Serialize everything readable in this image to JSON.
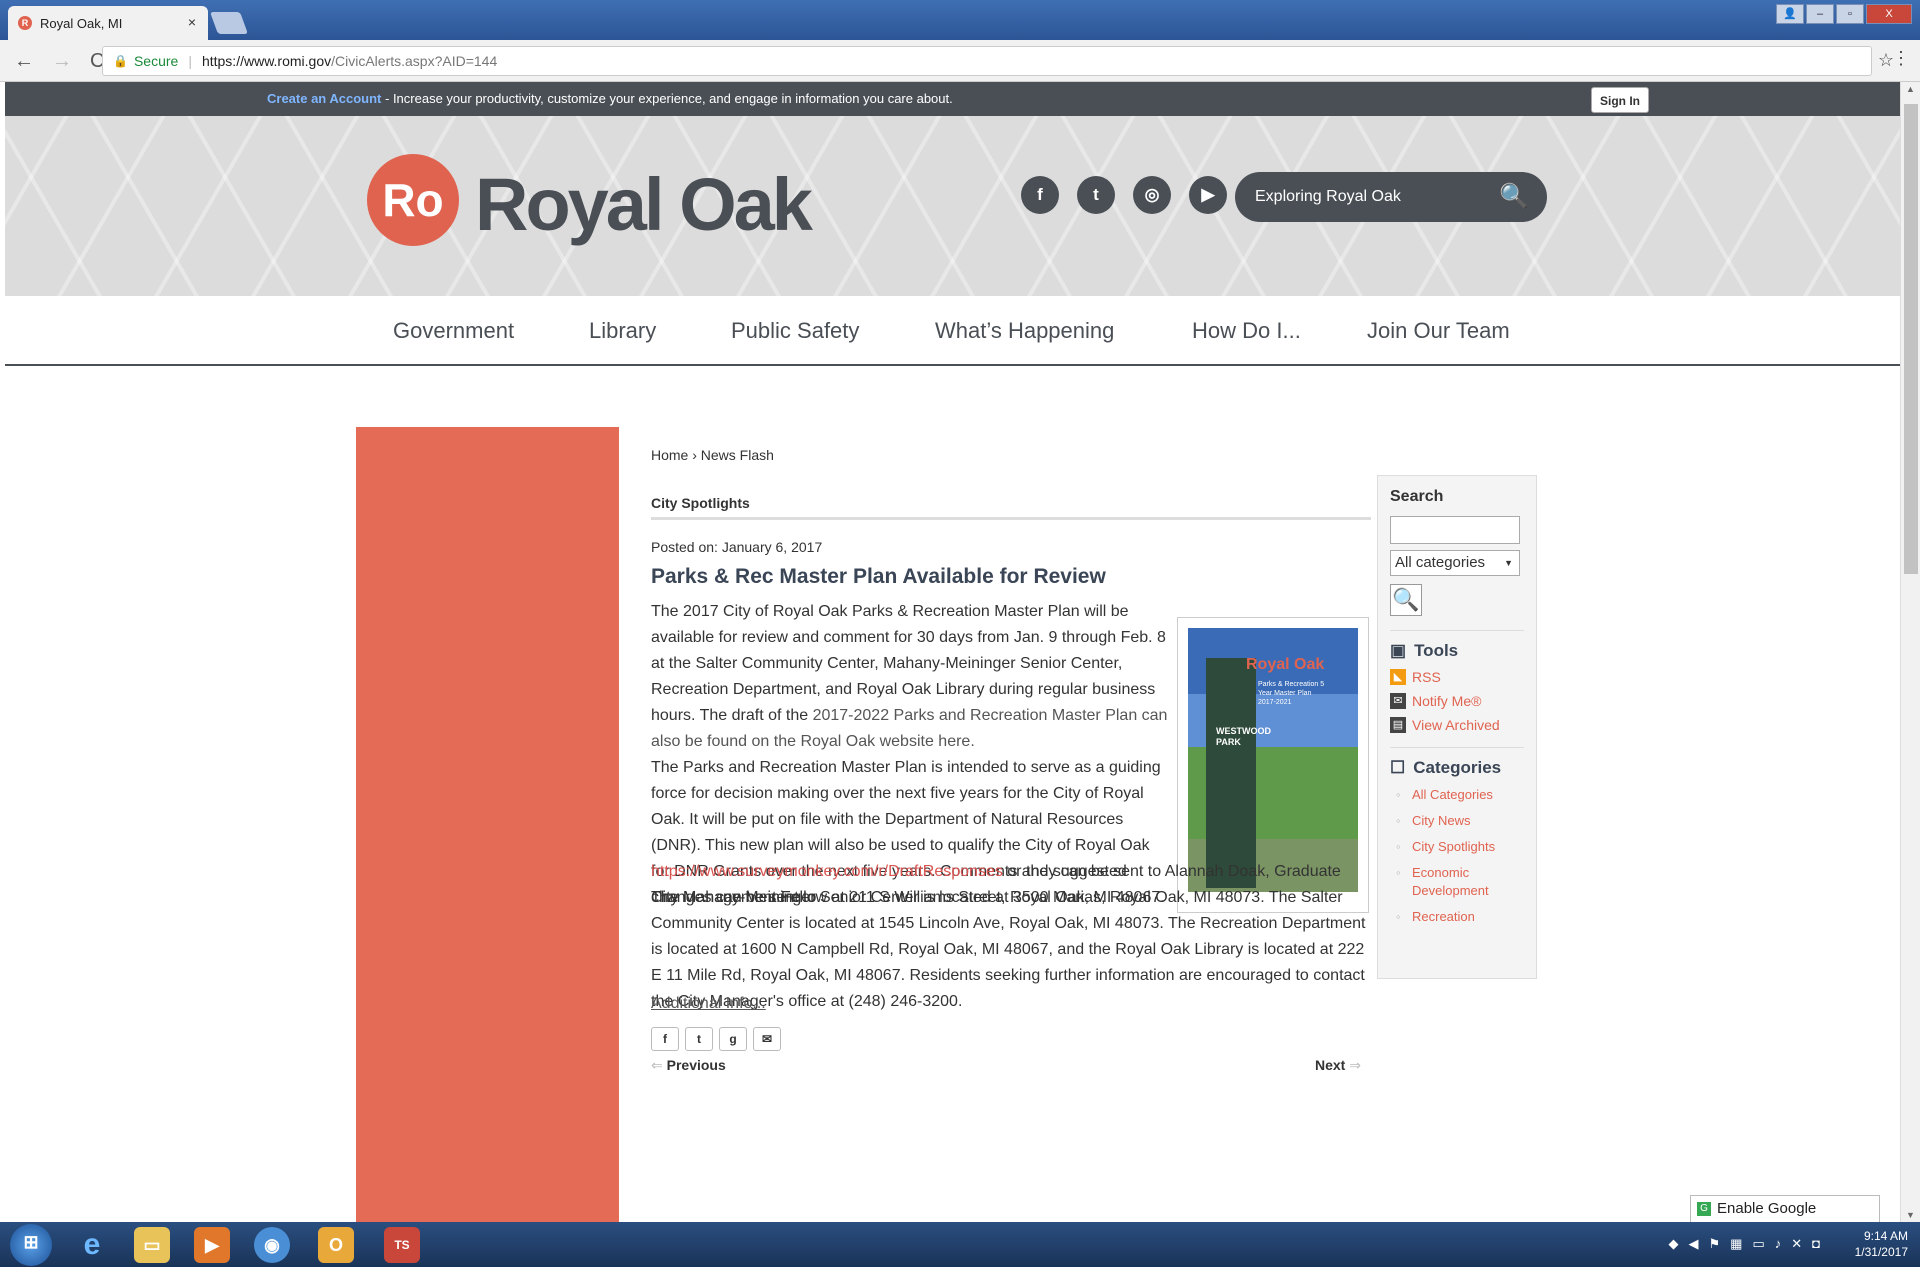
{
  "browser": {
    "tab_title": "Royal Oak, MI",
    "tab_close": "×",
    "secure_label": "Secure",
    "url_host": "https://www.romi.gov",
    "url_path": "/CivicAlerts.aspx?AID=144"
  },
  "topstrip": {
    "create_account": "Create an Account",
    "message": " - Increase your productivity, customize your experience, and engage in information you care about.",
    "sign_in": "Sign In"
  },
  "header": {
    "logo_mark": "Ro",
    "logo_text": "Royal Oak",
    "search_placeholder": "Exploring Royal Oak",
    "social": [
      "f",
      "t",
      "◎",
      "▶"
    ]
  },
  "nav": [
    "Government",
    "Library",
    "Public Safety",
    "What’s Happening",
    "How Do I...",
    "Join Our Team"
  ],
  "article": {
    "breadcrumb": "Home › News Flash",
    "section": "City Spotlights",
    "posted": "Posted on: January 6, 2017",
    "title": "Parks & Rec Master Plan Available for Review",
    "p1_text": "The 2017 City of Royal Oak Parks & Recreation Master Plan will be available for review and comment for 30 days from Jan. 9 through Feb. 8 at the Salter Community Center, Mahany-Meininger Senior Center, Recreation Department, and Royal Oak Library during regular business hours. The draft of the ",
    "p1_link": "2017-2022 Parks and Recreation Master Plan can also be found on the Royal Oak website here.",
    "p2_text": "The Parks and Recreation Master Plan is intended to serve as a guiding force for decision making over the next five years for the City of Royal Oak. It will be put on file with the Department of Natural Resources (DNR). This new plan will also be used to qualify the City of Royal Oak for DNR Grants over the next five years. Comments and suggested changes can be sent to",
    "p2_link": "https://www.surveymonkey.com/r/DraftResponses",
    "p2_tail": " or they can be sent to Alannah Doak, Graduate City Management Fellow at 211 S Williams Street, Royal Oak, MI 48067.",
    "p3_text": "The Mahany-Meininger Senior Center is located at 3500 Marias, Royal Oak, MI 48073. The Salter Community Center is located at 1545 Lincoln Ave, Royal Oak, MI 48073. The Recreation Department is located at 1600 N Campbell Rd, Royal Oak, MI 48067, and the Royal Oak Library is located at 222 E 11 Mile Rd, Royal Oak, MI 48067. Residents seeking further information are encouraged to contact the City Manager's office at (248) 246-3200.",
    "additional_info": "Additional Info...",
    "share": [
      "f",
      "t",
      "g",
      "✉"
    ],
    "previous": "Previous",
    "next": "Next",
    "image": {
      "brand": "Royal Oak",
      "subtitle": "Parks & Recreation 5 Year Master Plan 2017-2021",
      "park_sign": "WESTWOOD PARK"
    }
  },
  "right_panel": {
    "search_title": "Search",
    "category_select": "All categories",
    "tools_title": "Tools",
    "tools": [
      {
        "icon": "rss-icon",
        "label": "RSS"
      },
      {
        "icon": "mail-icon",
        "label": "Notify Me®"
      },
      {
        "icon": "archive-icon",
        "label": "View Archived"
      }
    ],
    "categories_title": "Categories",
    "categories": [
      "All Categories",
      "City News",
      "City Spotlights",
      "Economic Development",
      "Recreation"
    ]
  },
  "translate_label": "Enable Google Translate",
  "taskbar": {
    "time": "9:14 AM",
    "date": "1/31/2017"
  },
  "colors": {
    "accent_red": "#e46b56",
    "dark_gray": "#4a4f55",
    "link_red": "#e06350"
  }
}
